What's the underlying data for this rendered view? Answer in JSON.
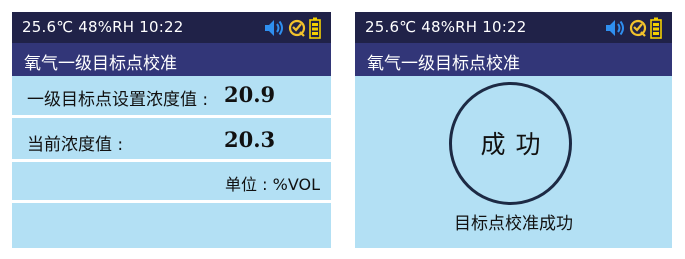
{
  "left_screen": {
    "status": {
      "text": "25.6℃ 48%RH 10:22"
    },
    "title": "氧气一级目标点校准",
    "rows": [
      {
        "label": "一级目标点设置浓度值 :",
        "value": "20.9"
      },
      {
        "label": "当前浓度值 :",
        "value": "20.3"
      },
      {
        "unit": "单位 : %VOL"
      }
    ]
  },
  "right_screen": {
    "status": {
      "text": "25.6℃ 48%RH 10:22"
    },
    "title": "氧气一级目标点校准",
    "result": "成功",
    "message": "目标点校准成功"
  },
  "icons": {
    "speaker": "speaker-icon",
    "sensor": "sensor-status-icon",
    "battery": "battery-icon"
  },
  "colors": {
    "status_bar": "#202248",
    "title_bar": "#323678",
    "screen_bg": "#b3e0f4",
    "speaker_icon": "#2f8ff0",
    "sensor_icon": "#f2c22c",
    "battery_icon": "#f4d000"
  }
}
